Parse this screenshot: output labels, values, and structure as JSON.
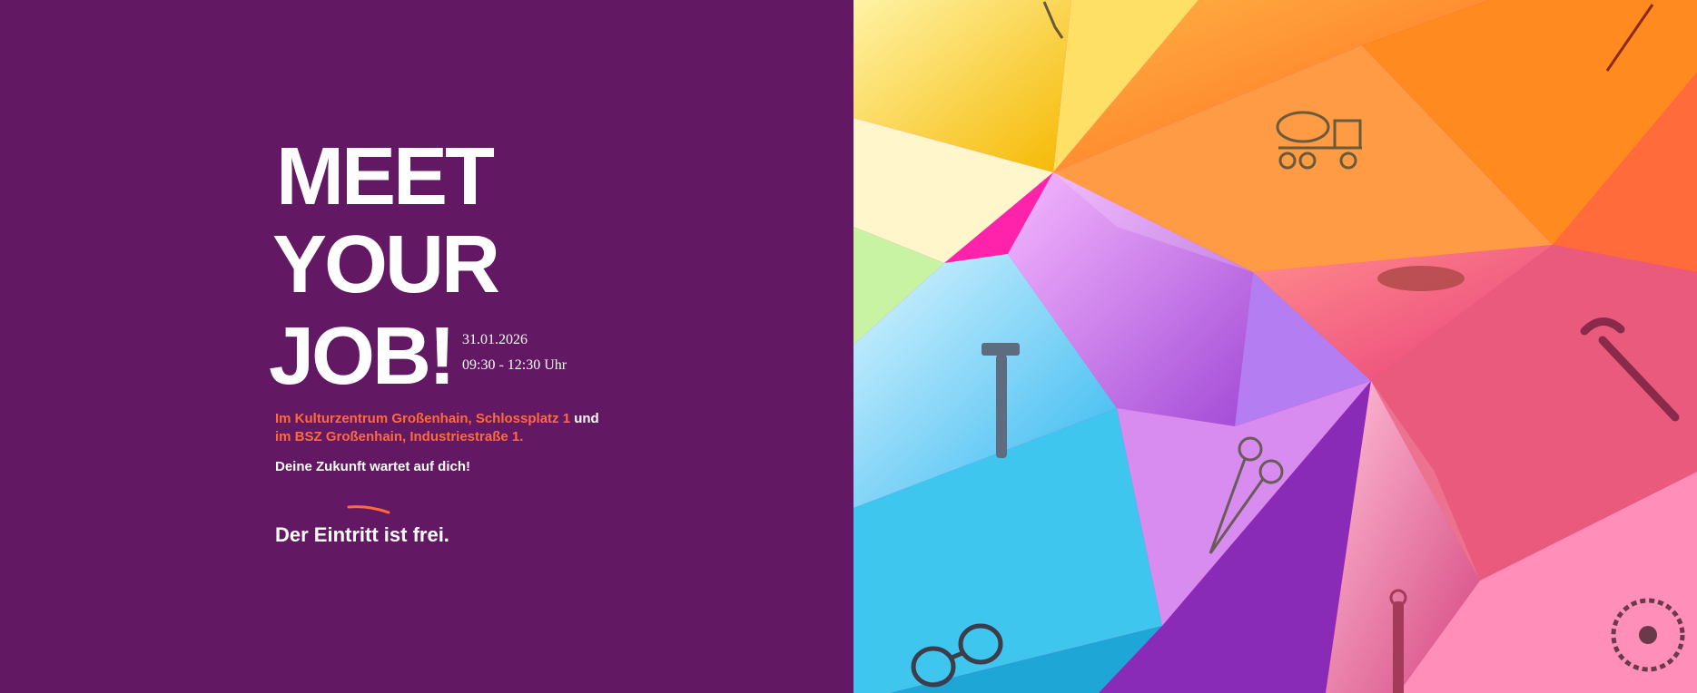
{
  "headline": {
    "line1": "MEET",
    "line2": "YOUR",
    "line3": "JOB!"
  },
  "event": {
    "date": "31.01.2026",
    "time": "09:30 - 12:30 Uhr"
  },
  "location": {
    "line1_highlight": "Im Kulturzentrum Großenhain, Schlossplatz 1",
    "line1_connector": " und",
    "line2_highlight": "im BSZ Großenhain, Industriestraße 1."
  },
  "slogan": "Deine Zukunft wartet auf dich!",
  "entry": "Der Eintritt ist frei.",
  "colors": {
    "background": "#621862",
    "accent": "#ff6a3d",
    "text": "#ffffff"
  },
  "illustration": {
    "icons": [
      "pipette-icon",
      "truck-icon",
      "bread-icon",
      "hammer-icon",
      "scissors-icon",
      "glasses-icon",
      "saw-blade-icon",
      "wrench-icon",
      "rake-icon",
      "file-icon"
    ]
  }
}
